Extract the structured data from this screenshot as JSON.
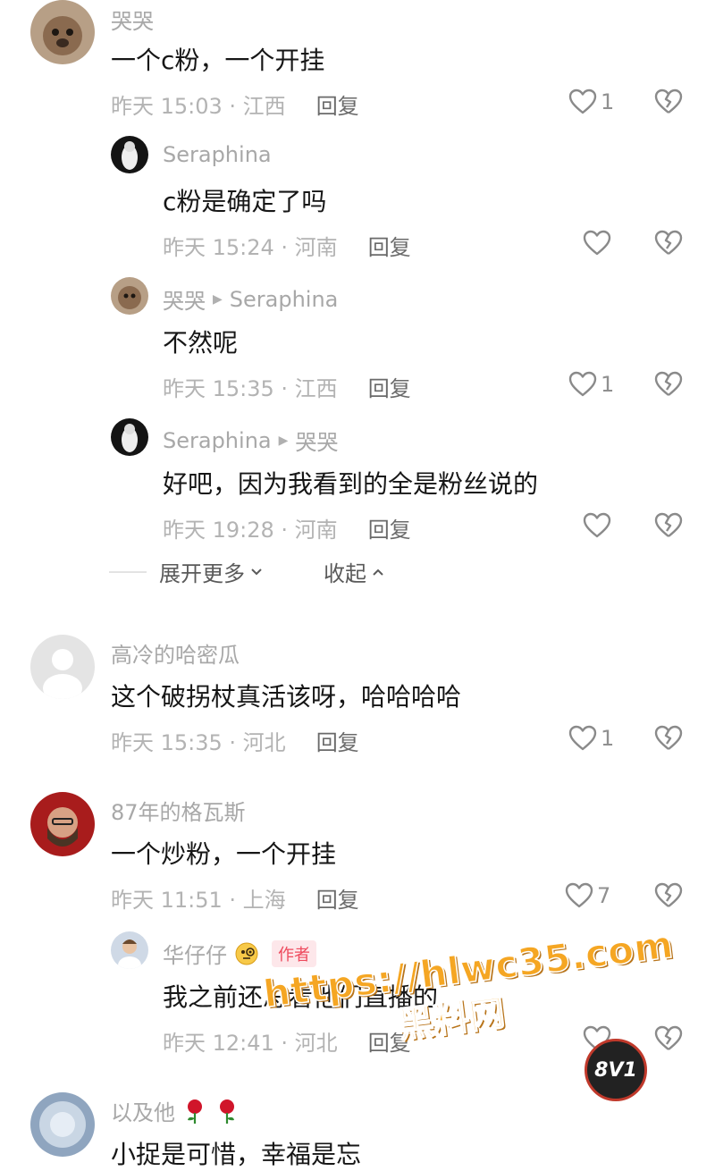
{
  "reply_label": "回复",
  "comments": [
    {
      "name": "哭哭",
      "text": "一个c粉，一个开挂",
      "time": "昨天 15:03 · 江西",
      "likes": "1"
    },
    {
      "name": "Seraphina",
      "text": "c粉是确定了吗",
      "time": "昨天 15:24 · 河南",
      "likes": ""
    },
    {
      "name": "哭哭",
      "reply_to": "Seraphina",
      "text": "不然呢",
      "time": "昨天 15:35 · 江西",
      "likes": "1"
    },
    {
      "name": "Seraphina",
      "reply_to": "哭哭",
      "text": "好吧，因为我看到的全是粉丝说的",
      "time": "昨天 19:28 · 河南",
      "likes": ""
    },
    {
      "name": "高冷的哈密瓜",
      "text": "这个破拐杖真活该呀，哈哈哈哈",
      "time": "昨天 15:35 · 河北",
      "likes": "1"
    },
    {
      "name": "87年的格瓦斯",
      "text": "一个炒粉，一个开挂",
      "time": "昨天 11:51 · 上海",
      "likes": "7"
    },
    {
      "name": "华仔仔",
      "badge": "作者",
      "text": "我之前还总看他们直播的",
      "time": "昨天 12:41 · 河北",
      "likes": ""
    },
    {
      "name": "以及他",
      "text": "小捉是可惜，幸福是忘",
      "time": "",
      "likes": ""
    }
  ],
  "thread_controls": {
    "expand": "展开更多",
    "collapse": "收起"
  },
  "watermark": {
    "url": "https://hlwc35.com",
    "site": "黑料网",
    "logo": "8V1"
  },
  "colors": {
    "accent": "#f5a623",
    "badge_bg": "#fde7ea",
    "badge_text": "#ee4a5d"
  }
}
